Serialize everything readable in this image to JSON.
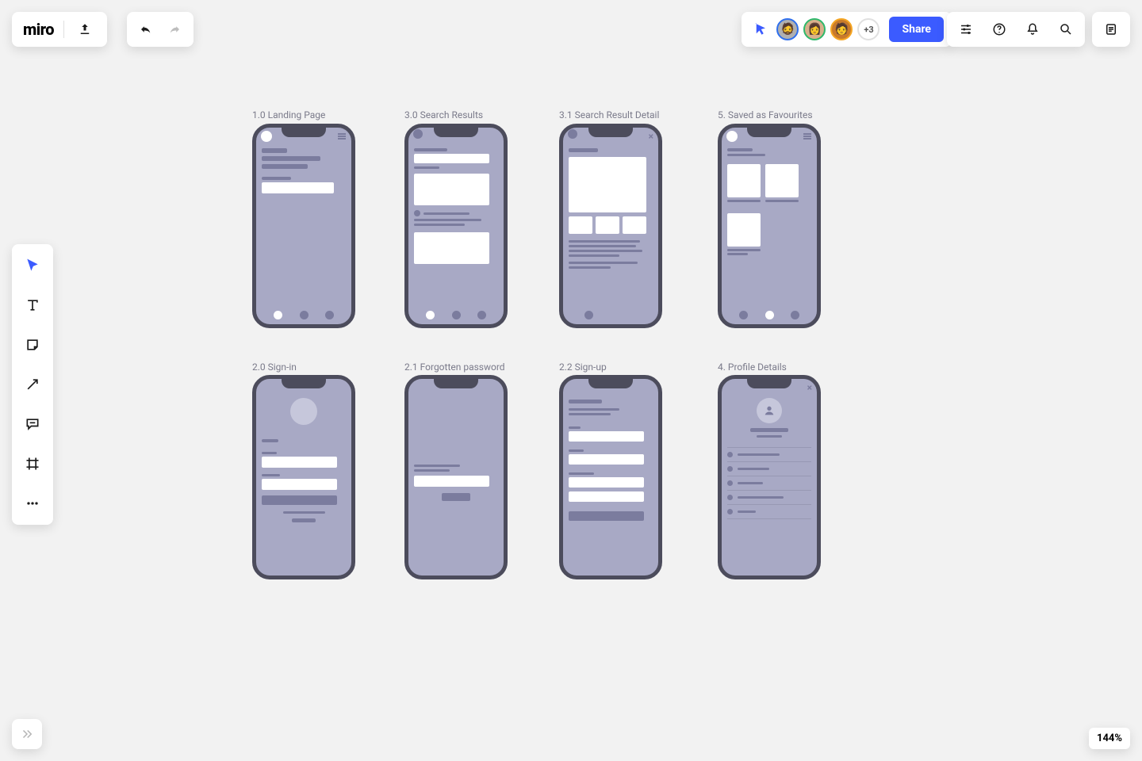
{
  "brand": "miro",
  "collab": {
    "overflow_label": "+3",
    "share_label": "Share"
  },
  "zoom": {
    "label": "144%"
  },
  "frames": {
    "landing": {
      "label": "1.0 Landing Page"
    },
    "results": {
      "label": "3.0 Search Results"
    },
    "detail": {
      "label": "3.1 Search Result Detail"
    },
    "favs": {
      "label": "5. Saved as Favourites"
    },
    "signin": {
      "label": "2.0 Sign-in"
    },
    "forgot": {
      "label": "2.1 Forgotten password"
    },
    "signup": {
      "label": "2.2 Sign-up"
    },
    "profile": {
      "label": "4. Profile Details"
    }
  }
}
